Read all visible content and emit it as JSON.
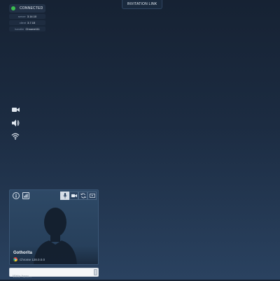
{
  "header": {
    "invitation_link_label": "INVITATION LINK"
  },
  "connection": {
    "status_label": "CONNECTED",
    "status_color": "#3bbf4f",
    "info": [
      {
        "key": "server",
        "value": "3.14.10"
      },
      {
        "key": "client",
        "value": "3.7.15"
      },
      {
        "key": "handler",
        "value": "Chrome111"
      }
    ]
  },
  "side_toolbar": {
    "items": [
      {
        "icon": "camera-icon"
      },
      {
        "icon": "speaker-icon"
      },
      {
        "icon": "wifi-icon"
      }
    ]
  },
  "video_card": {
    "info_icon": "info-icon",
    "stats_icon": "stats-icon",
    "controls": [
      {
        "icon": "microphone-icon",
        "active": true
      },
      {
        "icon": "camera-icon",
        "active": false
      },
      {
        "icon": "switch-camera-icon",
        "active": false
      },
      {
        "icon": "screen-share-icon",
        "active": false
      }
    ],
    "user_name": "Gothorita",
    "browser_label": "Chrome 128.0.0.0",
    "browser_icon": "chrome-icon"
  },
  "chat": {
    "placeholder": "Write here..."
  }
}
